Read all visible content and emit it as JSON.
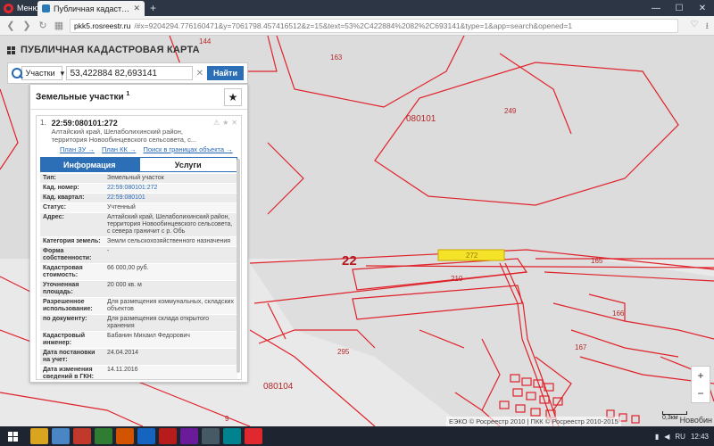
{
  "browser": {
    "menu_label": "Меню",
    "tab_title": "Публичная кадастровая к",
    "url_host": "pkk5.rosreestr.ru",
    "url_rest": "/#x=9204294.776160471&y=7061798.457416512&z=15&text=53%2C422884%2082%2C693141&type=1&app=search&opened=1"
  },
  "map": {
    "title": "ПУБЛИЧНАЯ КАДАСТРОВАЯ КАРТА",
    "labels": [
      {
        "name": "label-144",
        "text": "144"
      },
      {
        "name": "label-163",
        "text": "163"
      },
      {
        "name": "label-080101",
        "text": "080101"
      },
      {
        "name": "label-249",
        "text": "249"
      },
      {
        "name": "label-22",
        "text": "22"
      },
      {
        "name": "label-272",
        "text": "272"
      },
      {
        "name": "label-165",
        "text": "165"
      },
      {
        "name": "label-210",
        "text": "210"
      },
      {
        "name": "label-166",
        "text": "166"
      },
      {
        "name": "label-167",
        "text": "167"
      },
      {
        "name": "label-295",
        "text": "295"
      },
      {
        "name": "label-080104",
        "text": "080104"
      },
      {
        "name": "label-9",
        "text": "9"
      }
    ],
    "copyright": "ЕЭКО © Росреестр 2010 | ПКК © Росреестр 2010-2015",
    "scale": "0,3км",
    "city_label": "Новобин"
  },
  "search": {
    "type": "Участки",
    "value": "53,422884 82,693141",
    "button": "Найти"
  },
  "panel": {
    "title": "Земельные участки",
    "count": "1",
    "card": {
      "index": "1.",
      "cadastral_id": "22:59:080101:272",
      "address_line1": "Алтайский край, Шелаболихинский район,",
      "address_line2": "территория Новообинцевского сельсовета, с...",
      "link_plan_zu": "План ЗУ →",
      "link_plan_kk": "План КК →",
      "link_search": "Поиск в границах объекта →"
    },
    "tabs": {
      "info": "Информация",
      "services": "Услуги"
    },
    "rows": [
      {
        "k": "Тип:",
        "v": "Земельный участок",
        "link": false
      },
      {
        "k": "Кад. номер:",
        "v": "22:59:080101:272",
        "link": true
      },
      {
        "k": "Кад. квартал:",
        "v": "22:59:080101",
        "link": true
      },
      {
        "k": "Статус:",
        "v": "Учтенный",
        "link": false
      },
      {
        "k": "Адрес:",
        "v": "Алтайский край, Шелаболихинский район, территория Новообинцевского сельсовета, с севера граничит с р. Обь",
        "link": false
      },
      {
        "k": "Категория земель:",
        "v": "Земли сельскохозяйственного назначения",
        "link": false
      },
      {
        "k": "Форма собственности:",
        "v": "-",
        "link": false
      },
      {
        "k": "Кадастровая стоимость:",
        "v": "66 000,00 руб.",
        "link": false
      },
      {
        "k": "Уточненная площадь:",
        "v": "20 000 кв. м",
        "link": false
      },
      {
        "k": "Разрешенное использование:",
        "v": "Для размещения коммунальных, складских объектов",
        "link": false
      },
      {
        "k": "по документу:",
        "v": "Для размещения склада открытого хранения",
        "link": false
      },
      {
        "k": "Кадастровый инженер:",
        "v": "Бабанин Михаил Федорович",
        "link": false
      },
      {
        "k": "Дата постановки на учет:",
        "v": "24.04.2014",
        "link": false
      },
      {
        "k": "Дата изменения сведений в ГКН:",
        "v": "14.11.2016",
        "link": false
      },
      {
        "k": "Дата выгрузки сведений из ГКН:",
        "v": "15.11.2016",
        "link": false
      }
    ]
  },
  "taskbar": {
    "lang": "RU",
    "time": "12:43"
  },
  "colors": {
    "boundary": "#e0222a",
    "accent": "#2d6fb6",
    "parcel_highlight": "#f5e32a"
  }
}
